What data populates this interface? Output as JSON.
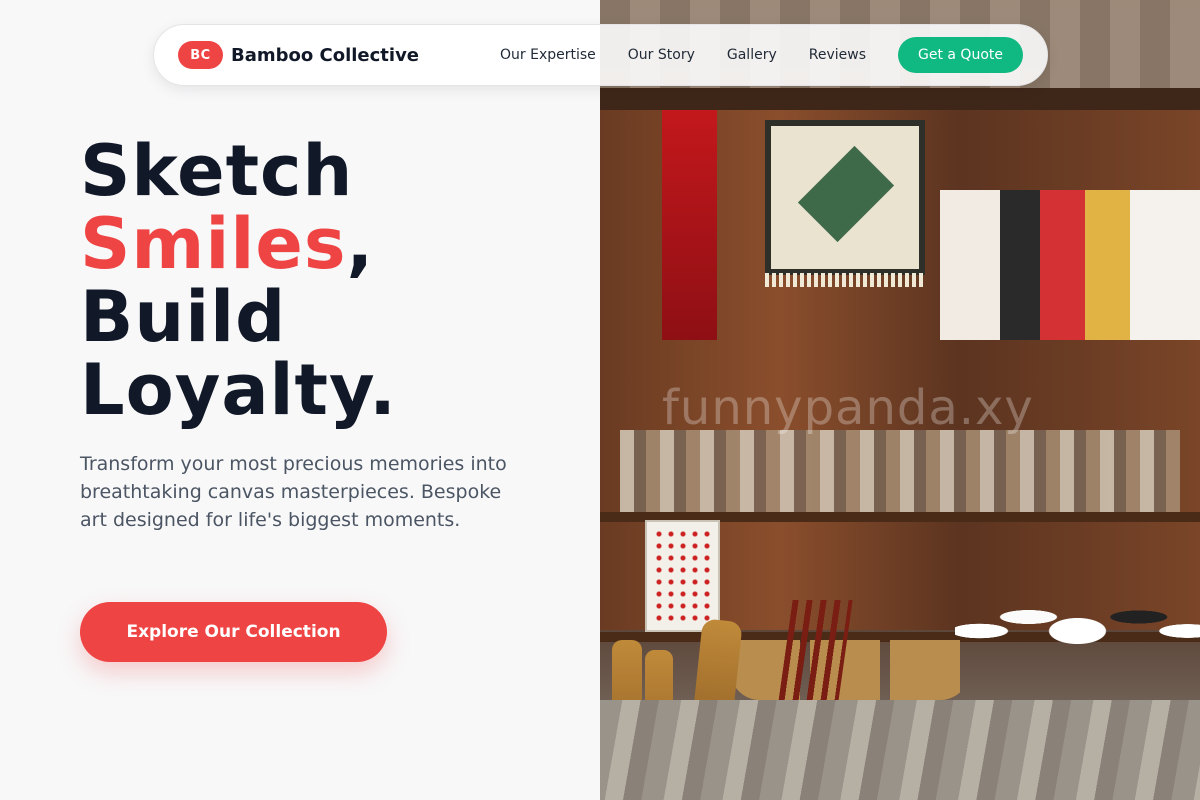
{
  "brand": {
    "badge": "BC",
    "name": "Bamboo Collective",
    "accent_color": "#ef4444"
  },
  "nav": {
    "links": [
      "Our Expertise",
      "Our Story",
      "Gallery",
      "Reviews"
    ],
    "cta_label": "Get a Quote",
    "cta_color": "#10b981"
  },
  "hero": {
    "title_line1": "Sketch",
    "title_accent": "Smiles",
    "title_comma": ",",
    "title_line3": "Build",
    "title_line4": "Loyalty.",
    "description": "Transform your most precious memories into breathtaking canvas masterpieces. Bespoke art designed for life's biggest moments.",
    "button_label": "Explore Our Collection"
  },
  "image": {
    "watermark": "funnypanda.xy",
    "subject": "market-stall-photo"
  }
}
